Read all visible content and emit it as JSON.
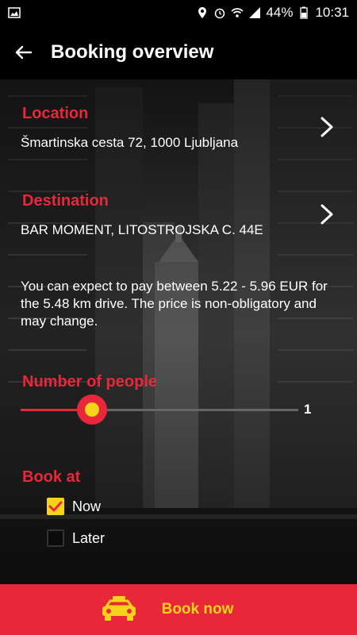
{
  "status_bar": {
    "battery": "44%",
    "time": "10:31"
  },
  "app_bar": {
    "title": "Booking overview",
    "back_icon": "arrow-left-icon"
  },
  "location": {
    "label": "Location",
    "value": "Šmartinska cesta 72, 1000 Ljubljana"
  },
  "destination": {
    "label": "Destination",
    "value": "BAR MOMENT, LITOSTROJSKA C. 44E"
  },
  "price_info": "You can expect to pay between 5.22 - 5.96 EUR for the 5.48 km drive. The price is non-obligatory and may change.",
  "people": {
    "label": "Number of people",
    "value": "1"
  },
  "book_at": {
    "label": "Book at",
    "options": [
      {
        "label": "Now",
        "checked": true
      },
      {
        "label": "Later",
        "checked": false
      }
    ]
  },
  "book_button": {
    "label": "Book now",
    "icon": "taxi-icon"
  },
  "colors": {
    "accent_red": "#e8283a",
    "accent_yellow": "#f5d31a"
  }
}
